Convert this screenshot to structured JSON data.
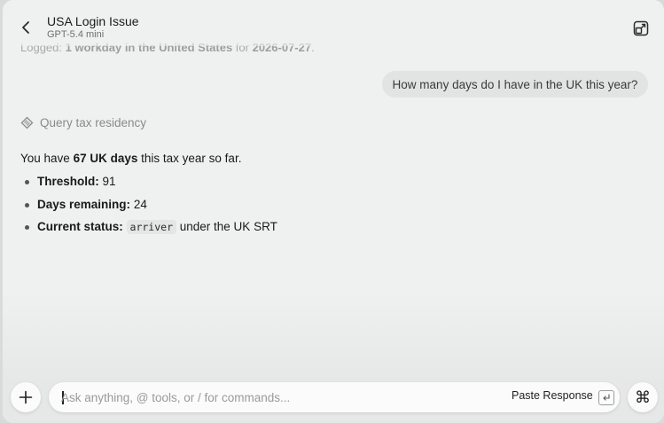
{
  "header": {
    "title": "USA Login Issue",
    "model": "GPT-5.4 mini"
  },
  "previous_message": {
    "prefix": "Logged:",
    "bold_1": "1 workday in the United States",
    "middle": "for",
    "bold_2": "2026-07-27",
    "suffix": "."
  },
  "user_message": "How many days do I have in the UK this year?",
  "tool_call": {
    "icon": "tool-sparkle-icon",
    "label": "Query tax residency"
  },
  "answer": {
    "intro_prefix": "You have",
    "intro_bold": "67 UK days",
    "intro_suffix": "this tax year so far.",
    "items": [
      {
        "label": "Threshold:",
        "value": "91"
      },
      {
        "label": "Days remaining:",
        "value": "24"
      },
      {
        "label": "Current status:",
        "code": "arriver",
        "value": "under the UK SRT"
      }
    ]
  },
  "composer": {
    "placeholder": "Ask anything, @ tools, or / for commands...",
    "value": "",
    "paste_label": "Paste Response",
    "plus_label": "+",
    "command_label": "⌘"
  }
}
